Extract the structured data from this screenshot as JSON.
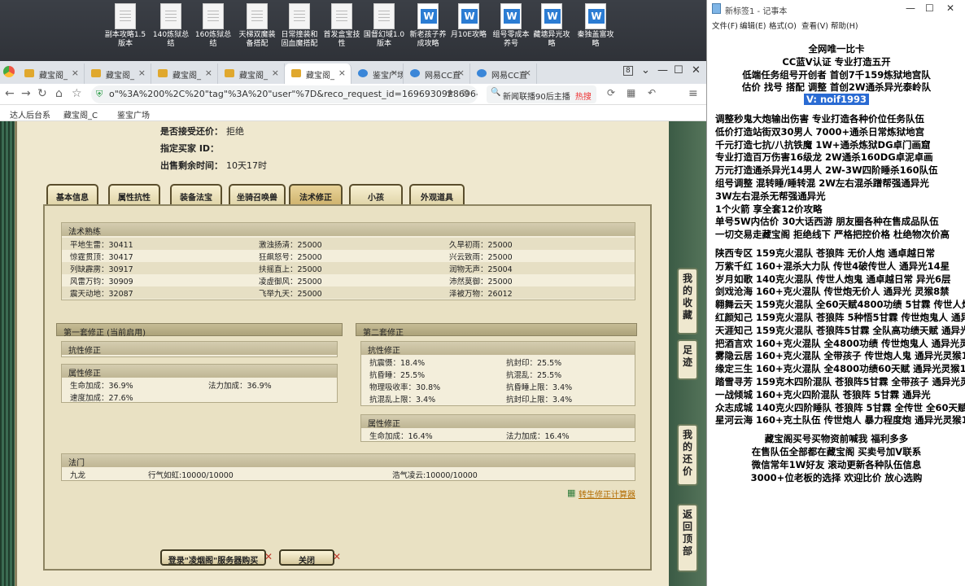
{
  "desktop": {
    "icons": [
      {
        "label": "副本攻略1.5版本",
        "type": "doc"
      },
      {
        "label": "140炼狱总结",
        "type": "doc"
      },
      {
        "label": "160炼狱总结",
        "type": "doc"
      },
      {
        "label": "天梯双魔装备搭配",
        "type": "doc"
      },
      {
        "label": "日常撞装和固血魔搭配",
        "type": "doc"
      },
      {
        "label": "首发盒宝技性",
        "type": "doc"
      },
      {
        "label": "国督幻域1.0版本",
        "type": "doc"
      },
      {
        "label": "新老孩子养成攻略",
        "type": "word"
      },
      {
        "label": "月10E攻略",
        "type": "word"
      },
      {
        "label": "组号零成本养号",
        "type": "word"
      },
      {
        "label": "藏塘异光攻略",
        "type": "word"
      },
      {
        "label": "秦独盖富攻略",
        "type": "word"
      }
    ]
  },
  "browser": {
    "tabs": [
      {
        "label": "藏宝阁_"
      },
      {
        "label": "藏宝阁_"
      },
      {
        "label": "藏宝阁_"
      },
      {
        "label": "藏宝阁_"
      },
      {
        "label": "藏宝阁_"
      },
      {
        "label": "鉴宝广场"
      },
      {
        "label": "网易CC直"
      },
      {
        "label": "网易CC直"
      }
    ],
    "tab_count": "8",
    "url": "o\"%3A%200%2C%20\"tag\"%3A%20\"user\"%7D&reco_request_id=1696930928696-NDWb",
    "search_text": "新闻联播90后主播",
    "search_badge": "热搜",
    "bookmarks": [
      "达人后台系",
      "藏宝阁_C",
      "鉴宝广场"
    ]
  },
  "page": {
    "info": [
      {
        "label": "是否接受还价：",
        "value": "拒绝"
      },
      {
        "label": "指定买家 ID：",
        "value": ""
      },
      {
        "label": "出售剩余时间：",
        "value": "10天17时"
      }
    ],
    "tabs": [
      "基本信息",
      "属性抗性",
      "装备法宝",
      "坐骑召唤兽",
      "法术修正",
      "小孩",
      "外观道具"
    ],
    "active_tab": "法术修正",
    "skills": {
      "title": "法术熟练",
      "rows": [
        [
          "平地生雷：30411",
          "激浊扬清：25000",
          "久旱初雨：25000"
        ],
        [
          "惊霆贯顶：30417",
          "狂飙怒号：25000",
          "兴云致雨：25000"
        ],
        [
          "列缺霹雳：30917",
          "扶摇直上：25000",
          "润物无声：25004"
        ],
        [
          "风雷万钧：30909",
          "凌虚御风：25000",
          "沛然莫御：25000"
        ],
        [
          "震天动地：32087",
          "飞举九天：25000",
          "泽被万物：26012"
        ]
      ]
    },
    "set1": {
      "title": "第一套修正 (当前启用)",
      "resist_title": "抗性修正",
      "attr_title": "属性修正",
      "attr_rows": [
        [
          "生命加成：36.9%",
          "法力加成：36.9%"
        ],
        [
          "速度加成：27.6%",
          ""
        ]
      ]
    },
    "set2": {
      "title": "第二套修正",
      "resist_title": "抗性修正",
      "resist_rows": [
        [
          "抗震慑：18.4%",
          "抗封印：25.5%"
        ],
        [
          "抗昏睡：25.5%",
          "抗混乱：25.5%"
        ],
        [
          "物理吸收率：30.8%",
          "抗昏睡上限：3.4%"
        ],
        [
          "抗混乱上限：3.4%",
          "抗封印上限：3.4%"
        ]
      ],
      "attr_title": "属性修正",
      "attr_rows": [
        [
          "生命加成：16.4%",
          "法力加成：16.4%"
        ]
      ]
    },
    "fameng": {
      "title": "法门",
      "row": [
        "九龙",
        "行气如虹:10000/10000",
        "浩气凌云:10000/10000"
      ]
    },
    "calc_link": "转生修正计算器",
    "buttons": {
      "login": "登录\"凌烟阁\"服务器购买",
      "close": "关闭"
    },
    "side": {
      "collect": "我的收藏",
      "footprint": "足迹",
      "bargain": "我的还价",
      "top": "返回顶部"
    }
  },
  "notepad": {
    "title": "新标签1 - 记事本",
    "menu": [
      "文件(F)",
      "编辑(E)",
      "格式(O)",
      "查看(V)",
      "帮助(H)"
    ],
    "lines": [
      "全网唯一比卡",
      "CC蓝V认证  专业打造五开",
      "低端任务组号开创者        首创7千159炼狱地宫队",
      "估价 找号 搭配 调整        首创2W通杀异光泰岭队",
      "V:  noif1993",
      "",
      "调整秒鬼大炮输出伤害          专业打造各种价位任务队伍",
      "低价打造站街双30男人           7000+通杀日常炼狱地宫",
      "千元打造七抗/八抗铁魔           1W+通杀炼狱DG卓门画窟",
      "专业打造百万伤害16级龙          2W通杀160DG卓泥卓画",
      "万元打造通杀异光14男人         2W-3W四阶睡杀160队伍",
      "组号调整 混转睡/睡转混          2W左右混杀蹭帮强通异光",
      "                                          3W左右混杀无帮强通异光",
      "1个火箭 享全套12价攻略",
      "单号5W内估价 30大话西游        朋友圈各种在售成品队伍",
      "一切交易走藏宝阁 拒绝线下     严格把控价格 杜绝物次价高",
      "",
      "陕西专区 159克火混队 苍狼阵 无价人炮 通卓越日常",
      "万紫千红 160+混杀大力队 传世4破传世人 通异光14星",
      "岁月如歌 140克火混队 传世人炮鬼 通卓越日常 异光6层",
      "剑戏沧海 160+克火混队 传世炮无价人 通异光 灵猴8禁",
      "翱舞云天 159克火混队 全60天赋4800功绩 5甘霖 传世人炮",
      "红颜知己 159克火混队 苍狼阵 5种悟5甘霖 传世炮鬼人 通异光",
      "天涯知己 159克火混队 苍狼阵5甘霖 全队高功绩天赋 通异光",
      "把酒言欢 160+克火混队 全4800功绩 传世炮鬼人 通异光灵猴",
      "雾隐云居 160+克火混队 全带孩子 传世炮人鬼 通异光灵猴14",
      "缘定三生 160+克火混队 全4800功绩60天赋 通异光灵猴14",
      "踏雪寻芳 159克木四阶混队 苍狼阵5甘霖 全带孩子 通异光灵猴",
      "一战倾城 160+克火四阶混队 苍狼阵 5甘霖 通异光",
      "众志成城 140克火四阶睡队 苍狼阵 5甘霖 全传世 全60天赋",
      "星河云海 160+克土队伍 传世炮人 暴力程度炮 通异光灵猴14",
      "",
      "藏宝阁买号买物资前喊我 福利多多",
      "在售队伍全部都在藏宝阁 买卖号加V联系",
      "微信常年1W好友 滚动更新各种队伍信息",
      "3000+位老板的选择 欢迎比价 放心选购"
    ]
  }
}
